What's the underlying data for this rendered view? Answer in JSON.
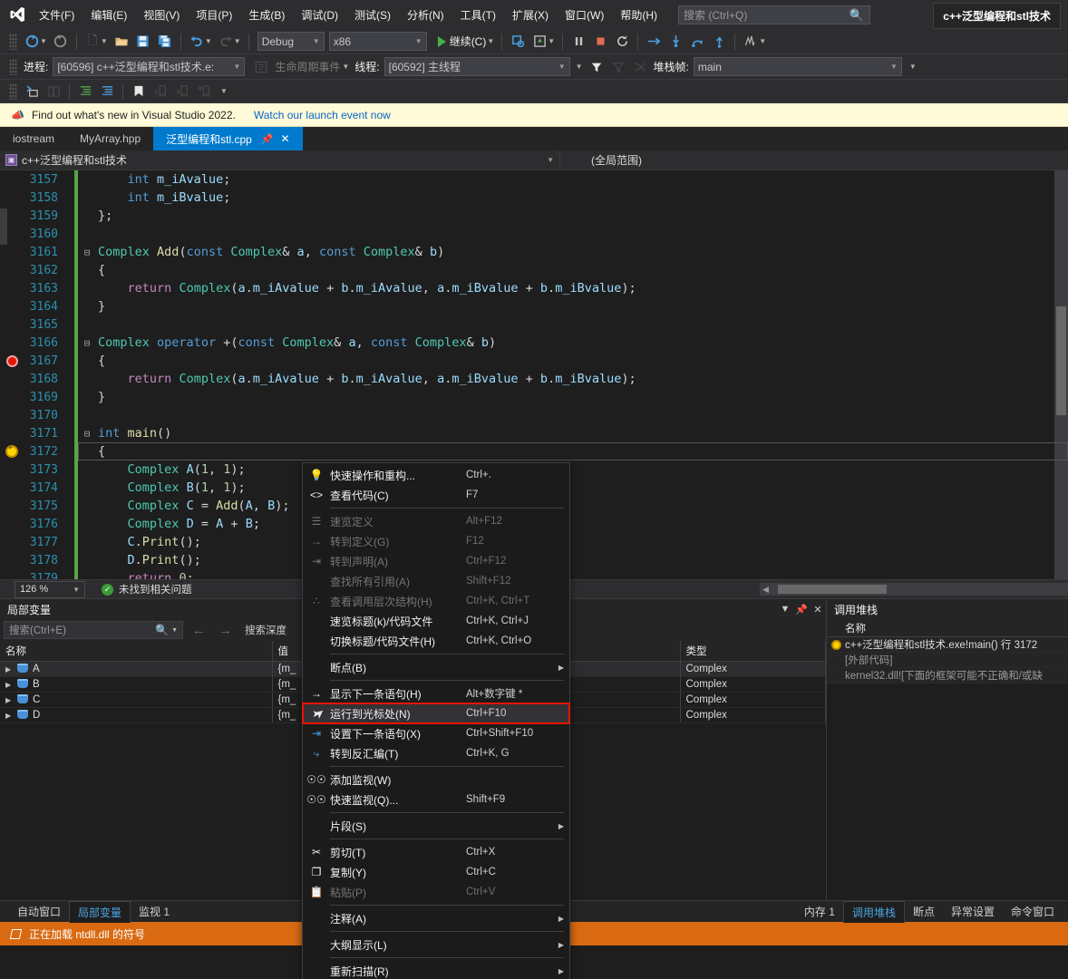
{
  "menubar": {
    "logo": "vs-logo-icon",
    "items": [
      "文件(F)",
      "编辑(E)",
      "视图(V)",
      "项目(P)",
      "生成(B)",
      "调试(D)",
      "测试(S)",
      "分析(N)",
      "工具(T)",
      "扩展(X)",
      "窗口(W)",
      "帮助(H)"
    ],
    "search_placeholder": "搜索 (Ctrl+Q)",
    "project_chip": "c++泛型编程和stl技术"
  },
  "toolbar1": {
    "config": "Debug",
    "platform": "x86",
    "continue_label": "继续(C)"
  },
  "toolbar2": {
    "process_label": "进程:",
    "process_value": "[60596] c++泛型编程和stl技术.e:",
    "lifecycle_label": "生命周期事件",
    "thread_label": "线程:",
    "thread_value": "[60592] 主线程",
    "frame_label": "堆栈帧:",
    "frame_value": "main"
  },
  "notification": {
    "text": "Find out what's new in Visual Studio 2022.",
    "link": "Watch our launch event now"
  },
  "tabs": [
    {
      "label": "iostream",
      "active": false
    },
    {
      "label": "MyArray.hpp",
      "active": false
    },
    {
      "label": "泛型编程和stl.cpp",
      "active": true
    }
  ],
  "navbar": {
    "scope_left": "c++泛型编程和stl技术",
    "scope_right": "(全局范围)"
  },
  "editor": {
    "zoom": "126 %",
    "issues": "未找到相关问题",
    "lines": [
      {
        "num": "3157",
        "bp": "",
        "fold": "",
        "html": "<span class=\"p\">    </span><span class=\"k\">int</span> <span class=\"v\">m_iAvalue</span><span class=\"p\">;</span>"
      },
      {
        "num": "3158",
        "bp": "",
        "fold": "",
        "html": "<span class=\"p\">    </span><span class=\"k\">int</span> <span class=\"v\">m_iBvalue</span><span class=\"p\">;</span>"
      },
      {
        "num": "3159",
        "bp": "",
        "fold": "",
        "html": "<span class=\"p\">};</span>"
      },
      {
        "num": "3160",
        "bp": "",
        "fold": "",
        "html": ""
      },
      {
        "num": "3161",
        "bp": "",
        "fold": "-",
        "html": "<span class=\"t\">Complex</span> <span class=\"f\">Add</span><span class=\"p\">(</span><span class=\"k\">const</span> <span class=\"t\">Complex</span><span class=\"p\">&amp;</span> <span class=\"v\">a</span><span class=\"p\">,</span> <span class=\"k\">const</span> <span class=\"t\">Complex</span><span class=\"p\">&amp;</span> <span class=\"v\">b</span><span class=\"p\">)</span>"
      },
      {
        "num": "3162",
        "bp": "",
        "fold": "",
        "html": "<span class=\"p\">{</span>"
      },
      {
        "num": "3163",
        "bp": "",
        "fold": "",
        "html": "<span class=\"p\">    </span><span class=\"kp\">return</span> <span class=\"t\">Complex</span><span class=\"p\">(</span><span class=\"v\">a</span><span class=\"p\">.</span><span class=\"v\">m_iAvalue</span> <span class=\"p\">+</span> <span class=\"v\">b</span><span class=\"p\">.</span><span class=\"v\">m_iAvalue</span><span class=\"p\">,</span> <span class=\"v\">a</span><span class=\"p\">.</span><span class=\"v\">m_iBvalue</span> <span class=\"p\">+</span> <span class=\"v\">b</span><span class=\"p\">.</span><span class=\"v\">m_iBvalue</span><span class=\"p\">);</span>"
      },
      {
        "num": "3164",
        "bp": "",
        "fold": "",
        "html": "<span class=\"p\">}</span>"
      },
      {
        "num": "3165",
        "bp": "",
        "fold": "",
        "html": ""
      },
      {
        "num": "3166",
        "bp": "",
        "fold": "-",
        "html": "<span class=\"t\">Complex</span> <span class=\"k\">operator</span> <span class=\"p\">+(</span><span class=\"k\">const</span> <span class=\"t\">Complex</span><span class=\"p\">&amp;</span> <span class=\"v\">a</span><span class=\"p\">,</span> <span class=\"k\">const</span> <span class=\"t\">Complex</span><span class=\"p\">&amp;</span> <span class=\"v\">b</span><span class=\"p\">)</span>"
      },
      {
        "num": "3167",
        "bp": "red",
        "fold": "",
        "html": "<span class=\"p\">{</span>"
      },
      {
        "num": "3168",
        "bp": "",
        "fold": "",
        "html": "<span class=\"p\">    </span><span class=\"kp\">return</span> <span class=\"t\">Complex</span><span class=\"p\">(</span><span class=\"v\">a</span><span class=\"p\">.</span><span class=\"v\">m_iAvalue</span> <span class=\"p\">+</span> <span class=\"v\">b</span><span class=\"p\">.</span><span class=\"v\">m_iAvalue</span><span class=\"p\">,</span> <span class=\"v\">a</span><span class=\"p\">.</span><span class=\"v\">m_iBvalue</span> <span class=\"p\">+</span> <span class=\"v\">b</span><span class=\"p\">.</span><span class=\"v\">m_iBvalue</span><span class=\"p\">);</span>"
      },
      {
        "num": "3169",
        "bp": "",
        "fold": "",
        "html": "<span class=\"p\">}</span>"
      },
      {
        "num": "3170",
        "bp": "",
        "fold": "",
        "html": ""
      },
      {
        "num": "3171",
        "bp": "",
        "fold": "-",
        "html": "<span class=\"k\">int</span> <span class=\"f\">main</span><span class=\"p\">()</span>"
      },
      {
        "num": "3172",
        "bp": "yellow",
        "fold": "",
        "html": "<span class=\"p\">{</span>"
      },
      {
        "num": "3173",
        "bp": "",
        "fold": "",
        "html": "<span class=\"p\">    </span><span class=\"t\">Complex</span> <span class=\"v\">A</span><span class=\"p\">(</span><span class=\"n\">1</span><span class=\"p\">,</span> <span class=\"n\">1</span><span class=\"p\">);</span>"
      },
      {
        "num": "3174",
        "bp": "",
        "fold": "",
        "html": "<span class=\"p\">    </span><span class=\"t\">Complex</span> <span class=\"v\">B</span><span class=\"p\">(</span><span class=\"n\">1</span><span class=\"p\">,</span> <span class=\"n\">1</span><span class=\"p\">);</span>"
      },
      {
        "num": "3175",
        "bp": "",
        "fold": "",
        "html": "<span class=\"p\">    </span><span class=\"t\">Complex</span> <span class=\"v\">C</span> <span class=\"p\">=</span> <span class=\"f\">Add</span><span class=\"p\">(</span><span class=\"v\">A</span><span class=\"p\">,</span> <span class=\"v\">B</span><span class=\"p\">);</span>"
      },
      {
        "num": "3176",
        "bp": "",
        "fold": "",
        "html": "<span class=\"p\">    </span><span class=\"t\">Complex</span> <span class=\"v\">D</span> <span class=\"p\">=</span> <span class=\"v\">A</span> <span class=\"p\">+</span> <span class=\"v\">B</span><span class=\"p\">;</span>"
      },
      {
        "num": "3177",
        "bp": "",
        "fold": "",
        "html": "<span class=\"p\">    </span><span class=\"v\">C</span><span class=\"p\">.</span><span class=\"f\">Print</span><span class=\"p\">();</span>"
      },
      {
        "num": "3178",
        "bp": "",
        "fold": "",
        "html": "<span class=\"p\">    </span><span class=\"v\">D</span><span class=\"p\">.</span><span class=\"f\">Print</span><span class=\"p\">();</span>"
      },
      {
        "num": "3179",
        "bp": "",
        "fold": "",
        "html": "<span class=\"p\">    </span><span class=\"kp\">return</span> <span class=\"n\">0</span><span class=\"p\">;</span>"
      }
    ]
  },
  "context_menu": {
    "items": [
      {
        "icon": "lightbulb-icon",
        "glyph": "💡",
        "label": "快速操作和重构...",
        "key": "Ctrl+.",
        "disabled": false,
        "sub": false
      },
      {
        "icon": "code-brackets-icon",
        "glyph": "<>",
        "label": "查看代码(C)",
        "key": "F7",
        "disabled": false,
        "sub": false
      },
      {
        "sep": true
      },
      {
        "icon": "peek-definition-icon",
        "glyph": "☰",
        "label": "速览定义",
        "key": "Alt+F12",
        "disabled": true,
        "sub": false
      },
      {
        "icon": "go-to-definition-icon",
        "glyph": "→",
        "label": "转到定义(G)",
        "key": "F12",
        "disabled": true,
        "sub": false
      },
      {
        "icon": "go-to-declaration-icon",
        "glyph": "⇥",
        "label": "转到声明(A)",
        "key": "Ctrl+F12",
        "disabled": true,
        "sub": false
      },
      {
        "icon": "find-references-icon",
        "glyph": "",
        "label": "查找所有引用(A)",
        "key": "Shift+F12",
        "disabled": true,
        "sub": false
      },
      {
        "icon": "call-hierarchy-icon",
        "glyph": "∴",
        "label": "查看调用层次结构(H)",
        "key": "Ctrl+K, Ctrl+T",
        "disabled": true,
        "sub": false
      },
      {
        "icon": "peek-header-icon",
        "glyph": "",
        "label": "速览标题(k)/代码文件",
        "key": "Ctrl+K, Ctrl+J",
        "disabled": false,
        "sub": false
      },
      {
        "icon": "toggle-header-icon",
        "glyph": "",
        "label": "切换标题/代码文件(H)",
        "key": "Ctrl+K, Ctrl+O",
        "disabled": false,
        "sub": false
      },
      {
        "sep": true
      },
      {
        "icon": "breakpoint-icon",
        "glyph": "",
        "label": "断点(B)",
        "key": "",
        "disabled": false,
        "sub": true
      },
      {
        "sep": true
      },
      {
        "icon": "show-next-statement-icon",
        "glyph": "→",
        "label": "显示下一条语句(H)",
        "key": "Alt+数字键 *",
        "disabled": false,
        "sub": false
      },
      {
        "icon": "run-to-cursor-icon",
        "glyph": "➤",
        "label": "运行到光标处(N)",
        "key": "Ctrl+F10",
        "disabled": false,
        "sub": false,
        "highlighted": true,
        "boxed": true
      },
      {
        "icon": "set-next-statement-icon",
        "glyph": "⇥",
        "label": "设置下一条语句(X)",
        "key": "Ctrl+Shift+F10",
        "disabled": false,
        "sub": false
      },
      {
        "icon": "go-to-disassembly-icon",
        "glyph": "⤷",
        "label": "转到反汇编(T)",
        "key": "Ctrl+K, G",
        "disabled": false,
        "sub": false
      },
      {
        "sep": true
      },
      {
        "icon": "add-watch-icon",
        "glyph": "☉☉",
        "label": "添加监视(W)",
        "key": "",
        "disabled": false,
        "sub": false
      },
      {
        "icon": "quick-watch-icon",
        "glyph": "☉☉",
        "label": "快速监视(Q)...",
        "key": "Shift+F9",
        "disabled": false,
        "sub": false
      },
      {
        "sep": true
      },
      {
        "icon": "snippet-icon",
        "glyph": "",
        "label": "片段(S)",
        "key": "",
        "disabled": false,
        "sub": true
      },
      {
        "sep": true
      },
      {
        "icon": "cut-icon",
        "glyph": "✂",
        "label": "剪切(T)",
        "key": "Ctrl+X",
        "disabled": false,
        "sub": false
      },
      {
        "icon": "copy-icon",
        "glyph": "❐",
        "label": "复制(Y)",
        "key": "Ctrl+C",
        "disabled": false,
        "sub": false
      },
      {
        "icon": "paste-icon",
        "glyph": "📋",
        "label": "粘贴(P)",
        "key": "Ctrl+V",
        "disabled": true,
        "sub": false
      },
      {
        "sep": true
      },
      {
        "icon": "comment-icon",
        "glyph": "",
        "label": "注释(A)",
        "key": "",
        "disabled": false,
        "sub": true
      },
      {
        "sep": true
      },
      {
        "icon": "outlining-icon",
        "glyph": "",
        "label": "大纲显示(L)",
        "key": "",
        "disabled": false,
        "sub": true
      },
      {
        "sep": true
      },
      {
        "icon": "rescan-icon",
        "glyph": "",
        "label": "重新扫描(R)",
        "key": "",
        "disabled": false,
        "sub": true
      }
    ]
  },
  "locals_panel": {
    "title": "局部变量",
    "search_placeholder": "搜索(Ctrl+E)",
    "depth_label": "搜索深度",
    "columns": [
      "名称",
      "值",
      "类型"
    ],
    "rows": [
      {
        "name": "A",
        "value": "{m_",
        "type": "Complex"
      },
      {
        "name": "B",
        "value": "{m_",
        "type": "Complex"
      },
      {
        "name": "C",
        "value": "{m_",
        "type": "Complex"
      },
      {
        "name": "D",
        "value": "{m_",
        "type": "Complex"
      }
    ]
  },
  "callstack_panel": {
    "title": "调用堆栈",
    "column": "名称",
    "rows": [
      {
        "text": "c++泛型编程和stl技术.exe!main() 行 3172",
        "current": true,
        "dim": false
      },
      {
        "text": "[外部代码]",
        "current": false,
        "dim": true
      },
      {
        "text": "kernel32.dll![下面的框架可能不正确和/或缺",
        "current": false,
        "dim": true
      }
    ]
  },
  "bottom_tabs_left": [
    {
      "label": "自动窗口",
      "active": false
    },
    {
      "label": "局部变量",
      "active": true
    },
    {
      "label": "监视 1",
      "active": false
    }
  ],
  "bottom_tabs_right": [
    {
      "label": "内存 1",
      "active": false
    },
    {
      "label": "调用堆栈",
      "active": true
    },
    {
      "label": "断点",
      "active": false
    },
    {
      "label": "异常设置",
      "active": false
    },
    {
      "label": "命令窗口",
      "active": false
    }
  ],
  "statusbar": {
    "text": "正在加载 ntdll.dll 的符号"
  },
  "colors": {
    "accent": "#007acc",
    "status_orange": "#d96a12",
    "breakpoint_red": "#e51400",
    "current_line_yellow": "#ffd400",
    "notification_bg": "#fffbd8"
  }
}
